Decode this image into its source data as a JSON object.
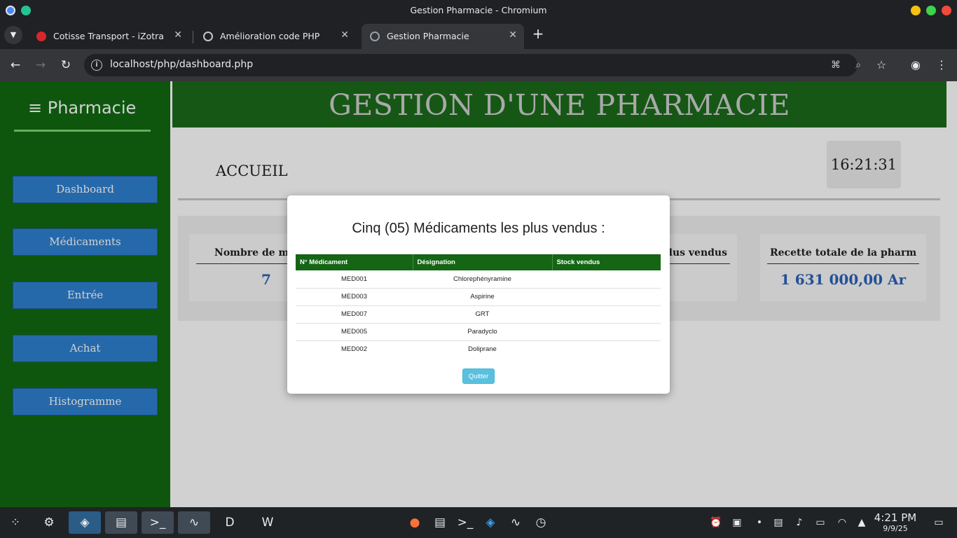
{
  "window": {
    "title": "Gestion Pharmacie - Chromium"
  },
  "tabs": [
    {
      "label": "Cotisse Transport - iZotra",
      "active": false
    },
    {
      "label": "Amélioration code PHP",
      "active": false
    },
    {
      "label": "Gestion Pharmacie",
      "active": true
    }
  ],
  "address_bar": {
    "url": "localhost/php/dashboard.php"
  },
  "sidebar": {
    "brand": "≡ Pharmacie",
    "items": [
      {
        "label": "Dashboard"
      },
      {
        "label": "Médicaments"
      },
      {
        "label": "Entrée"
      },
      {
        "label": "Achat"
      },
      {
        "label": "Histogramme"
      }
    ]
  },
  "header": {
    "title": "GESTION D'UNE PHARMACIE"
  },
  "page": {
    "section_title": "ACCUEIL",
    "clock": "16:21:31"
  },
  "cards": [
    {
      "title": "Nombre de médica",
      "value": "7"
    },
    {
      "title": "es plus vendus",
      "value": ""
    },
    {
      "title": "Recette totale de la pharmacie",
      "value": "1 631 000,00 Ar"
    }
  ],
  "modal": {
    "title": "Cinq (05) Médicaments les plus vendus :",
    "columns": [
      "N° Médicament",
      "Désignation",
      "Stock vendus"
    ],
    "rows": [
      [
        "MED001",
        "Chlorephényramine",
        ""
      ],
      [
        "MED003",
        "Aspirine",
        ""
      ],
      [
        "MED007",
        "GRT",
        ""
      ],
      [
        "MED005",
        "Paradyclo",
        ""
      ],
      [
        "MED002",
        "Doliprane",
        ""
      ]
    ],
    "quit_label": "Quitter"
  },
  "taskbar": {
    "time": "4:21 PM",
    "date": "9/9/25"
  },
  "colors": {
    "sidebar": "#126a12",
    "header": "#1b6b1b",
    "button_blue": "#2f80d1",
    "table_header": "#146514",
    "quit_button": "#5bc0de",
    "value_blue": "#2a62b8"
  }
}
